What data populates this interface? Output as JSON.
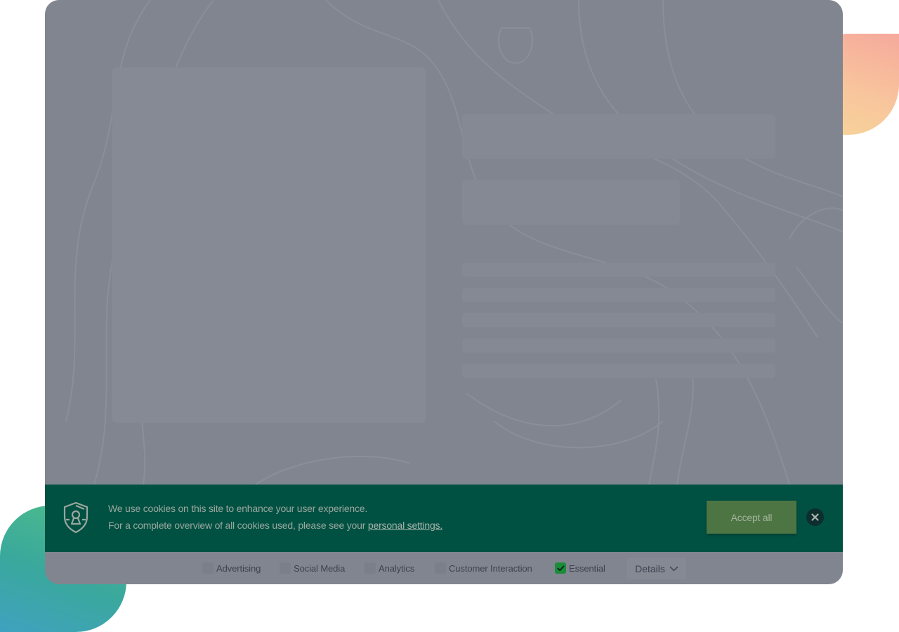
{
  "cookie_banner": {
    "message_line1": "We use cookies on this site to enhance your user experience.",
    "message_line2_prefix": "For a complete overview of all cookies used, please see your ",
    "settings_link": "personal settings.",
    "accept_label": "Accept all",
    "close_icon": "close-icon",
    "shield_icon": "shield-keyhole-icon",
    "background_color": "#005142",
    "accept_color": "#4d7544"
  },
  "consent_options": [
    {
      "label": "Advertising",
      "checked": false
    },
    {
      "label": "Social Media",
      "checked": false
    },
    {
      "label": "Analytics",
      "checked": false
    },
    {
      "label": "Customer Interaction",
      "checked": false
    },
    {
      "label": "Essential",
      "checked": true
    }
  ],
  "details": {
    "label": "Details",
    "icon": "chevron-down-icon"
  },
  "colors": {
    "overlay": "#80858f",
    "checkbox_checked": "#1a8c3a"
  }
}
